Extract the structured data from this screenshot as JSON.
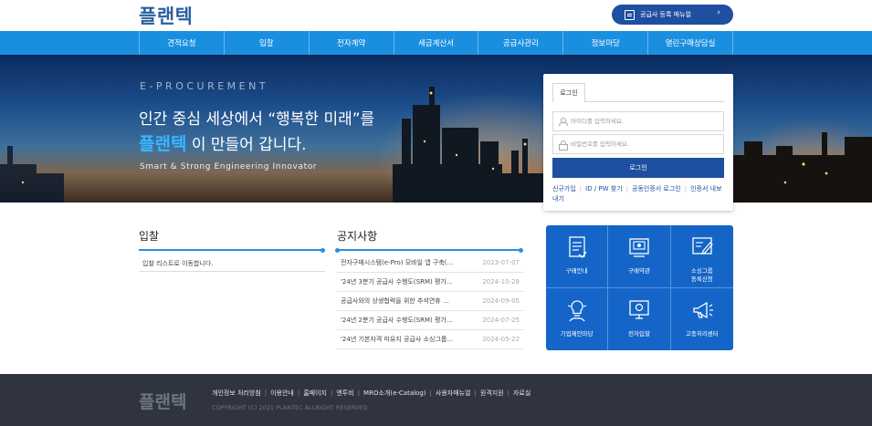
{
  "header": {
    "logo": "플랜텍",
    "register_button": "공급사 등록 매뉴얼"
  },
  "nav": {
    "items": [
      "견적요청",
      "입찰",
      "전자계약",
      "세금계산서",
      "공급사관리",
      "정보마당",
      "열린구매상담실"
    ]
  },
  "hero": {
    "eyebrow": "E-PROCUREMENT",
    "line1": "인간 중심 세상에서 “행복한 미래”를",
    "line2_brand": "플랜텍",
    "line2_rest": " 이 만들어 갑니다.",
    "english": "Smart & Strong Engineering Innovator"
  },
  "login": {
    "tab": "로그인",
    "id_placeholder": "아이디를 입력하세요.",
    "pw_placeholder": "비밀번호를 입력하세요.",
    "button": "로그인",
    "links": [
      "신규가입",
      "ID / PW 찾기",
      "공동인증서 로그인",
      "인증서 내보내기"
    ]
  },
  "bid": {
    "title": "입찰",
    "items": [
      "입찰 리스트로 이동합니다."
    ]
  },
  "notice": {
    "title": "공지사항",
    "items": [
      {
        "title": "전자구매시스템(e-Pro) 모바일 앱 구축(…",
        "date": "2023-07-07"
      },
      {
        "title": "'24년 3분기 공급사 수행도(SRM) 평가…",
        "date": "2024-10-28"
      },
      {
        "title": "공급사와의 상생협력을 위한 추석연휴 …",
        "date": "2024-09-05"
      },
      {
        "title": "'24년 2분기 공급사 수행도(SRM) 평가…",
        "date": "2024-07-25"
      },
      {
        "title": "'24년 기본자격 미유지 공급사 소싱그룹…",
        "date": "2024-05-22"
      }
    ]
  },
  "quick_menu": {
    "items": [
      {
        "label": "구매안내",
        "icon": "document-icon"
      },
      {
        "label": "구매약관",
        "icon": "terms-icon"
      },
      {
        "label": "소싱그룹\n등록신청",
        "icon": "register-icon"
      },
      {
        "label": "기업제안마당",
        "icon": "idea-icon"
      },
      {
        "label": "전자입찰",
        "icon": "bid-icon"
      },
      {
        "label": "고충처리센터",
        "icon": "megaphone-icon"
      }
    ]
  },
  "footer": {
    "logo": "플랜텍",
    "links": [
      "개인정보 처리방침",
      "이용안내",
      "홈페이지",
      "엔투비",
      "MRO소개(e-Catalog)",
      "사용자매뉴얼",
      "원격지원",
      "자료실"
    ],
    "copyright": "COPYRIGHT (C) 2021 PLANTEC ALLRIGHT RESERVED."
  },
  "colors": {
    "nav_blue": "#1a8fe0",
    "brand_navy": "#1f4fa0",
    "quick_blue": "#1565c8",
    "footer_bg": "#2f3440",
    "hero_highlight": "#39b6ff"
  }
}
